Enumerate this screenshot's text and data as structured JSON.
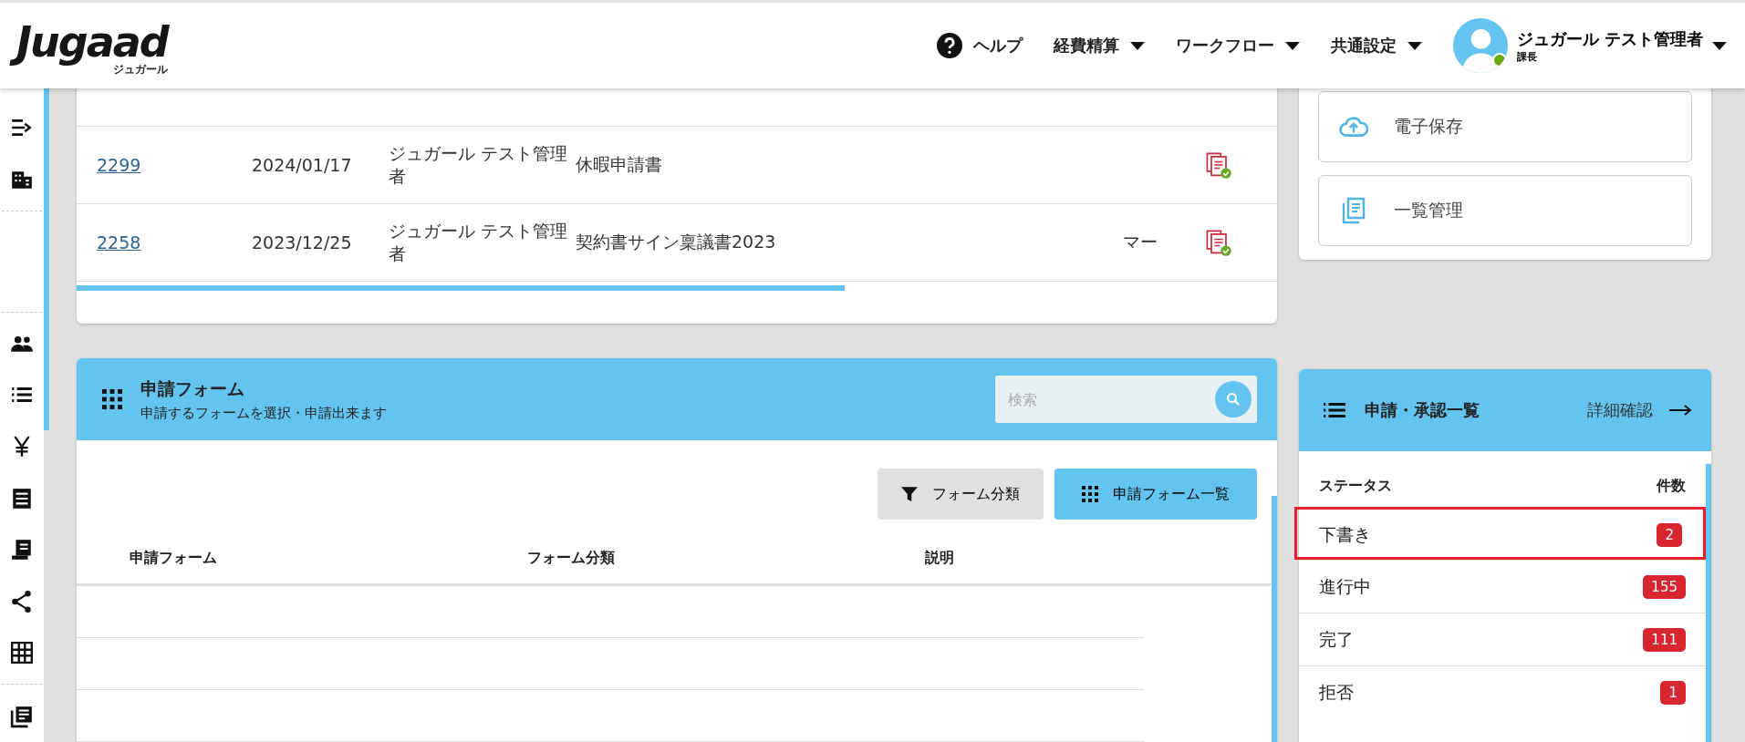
{
  "header": {
    "logo": "Jugaad",
    "logo_sub": "ジュガール",
    "nav": [
      {
        "label": "ヘルプ",
        "kind": "help"
      },
      {
        "label": "経費精算",
        "kind": "dropdown"
      },
      {
        "label": "ワークフロー",
        "kind": "dropdown"
      },
      {
        "label": "共通設定",
        "kind": "dropdown"
      }
    ],
    "user": {
      "name": "ジュガール テスト管理者",
      "role": "課長",
      "online": true
    }
  },
  "sidebar": {
    "items": [
      {
        "kind": "collapse"
      },
      {
        "kind": "building"
      },
      {
        "kind": "divider"
      },
      {
        "kind": "gap"
      },
      {
        "kind": "divider"
      },
      {
        "kind": "people"
      },
      {
        "kind": "list"
      },
      {
        "kind": "yen"
      },
      {
        "kind": "receipt"
      },
      {
        "kind": "bill"
      },
      {
        "kind": "share"
      },
      {
        "kind": "grid"
      },
      {
        "kind": "divider"
      },
      {
        "kind": "news"
      }
    ]
  },
  "documents": {
    "rows": [
      {
        "id": "2299",
        "date": "2024/01/17",
        "applicant": "ジュガール テスト管理者",
        "title": "休暇申請書"
      },
      {
        "id": "2258",
        "date": "2023/12/25",
        "applicant": "ジュガール テスト管理者",
        "title": "契約書サイン稟議書2023",
        "column_5": "マー"
      }
    ],
    "scroll": {
      "level": 0.64
    }
  },
  "shortcuts": [
    {
      "label": "電子保存",
      "kind": "cloud"
    },
    {
      "label": "一覧管理",
      "kind": "list"
    }
  ],
  "forms": {
    "title": "申請フォーム",
    "subtitle": "申請するフォームを選択・申請出来ます",
    "search": {
      "placeholder": "検索"
    },
    "buttons": [
      {
        "label": "フォーム分類",
        "kind": "filter"
      },
      {
        "label": "申請フォーム一覧",
        "kind": "grid"
      }
    ],
    "columns": [
      "申請フォーム",
      "フォーム分類",
      "説明"
    ]
  },
  "status": {
    "title": "申請・承認一覧",
    "link": "詳細確認",
    "columns": [
      "ステータス",
      "件数"
    ],
    "rows": [
      {
        "label": "下書き",
        "count": "2",
        "highlighted": true
      },
      {
        "label": "進行中",
        "count": "155",
        "highlighted": false
      },
      {
        "label": "完了",
        "count": "111",
        "highlighted": false
      },
      {
        "label": "拒否",
        "count": "1",
        "highlighted": false
      }
    ]
  }
}
